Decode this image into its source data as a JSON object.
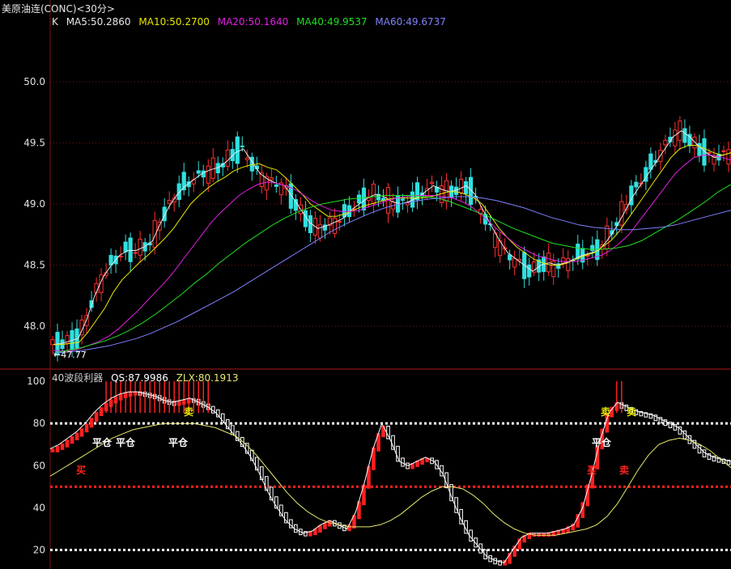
{
  "header": {
    "title": "美原油连(CONC)<30分>"
  },
  "colors": {
    "ma5": "#e8e8e8",
    "ma10": "#e8e800",
    "ma20": "#e020e0",
    "ma40": "#20e020",
    "ma60": "#8080ff",
    "up": "#ff3030",
    "down": "#30e0e0",
    "grid": "#7a1414",
    "qs": "#ffffff",
    "zlx": "#e8e870"
  },
  "ma_legend": {
    "k": "K",
    "ma5": "MA5:50.2860",
    "ma10": "MA10:50.2700",
    "ma20": "MA20:50.1640",
    "ma40": "MA40:49.9537",
    "ma60": "MA60:49.6737"
  },
  "indicator_legend": {
    "name": "40波段利器",
    "qs": "QS:87.9986",
    "zlx": "ZLX:80.1913"
  },
  "chart_data": [
    {
      "type": "candlestick",
      "title": "美原油连(CONC)<30分>",
      "y_ticks": [
        "50.0",
        "49.5",
        "49.0",
        "48.5",
        "48.0"
      ],
      "ylim": [
        47.65,
        50.55
      ],
      "min_label": "47.77",
      "series": [
        {
          "name": "MA5",
          "values": [
            47.85,
            47.86,
            47.88,
            47.9,
            48.05,
            48.25,
            48.4,
            48.5,
            48.58,
            48.62,
            48.62,
            48.65,
            48.7,
            48.85,
            48.98,
            49.08,
            49.15,
            49.2,
            49.25,
            49.28,
            49.3,
            49.35,
            49.42,
            49.45,
            49.35,
            49.25,
            49.2,
            49.17,
            49.15,
            49.05,
            48.95,
            48.85,
            48.8,
            48.82,
            48.85,
            48.88,
            48.95,
            49.0,
            49.05,
            49.08,
            49.06,
            49.02,
            49.0,
            49.02,
            49.05,
            49.1,
            49.15,
            49.12,
            49.1,
            49.12,
            49.15,
            49.08,
            48.95,
            48.82,
            48.7,
            48.6,
            48.55,
            48.5,
            48.45,
            48.5,
            48.52,
            48.5,
            48.52,
            48.55,
            48.58,
            48.6,
            48.62,
            48.7,
            48.8,
            48.92,
            49.05,
            49.15,
            49.25,
            49.35,
            49.45,
            49.55,
            49.6,
            49.55,
            49.48,
            49.42,
            49.38,
            49.4,
            49.42
          ]
        },
        {
          "name": "MA10",
          "values": [
            47.85,
            47.85,
            47.86,
            47.87,
            47.95,
            48.05,
            48.15,
            48.28,
            48.38,
            48.45,
            48.52,
            48.58,
            48.65,
            48.72,
            48.8,
            48.9,
            49.0,
            49.07,
            49.13,
            49.18,
            49.22,
            49.27,
            49.3,
            49.32,
            49.33,
            49.3,
            49.28,
            49.22,
            49.15,
            49.08,
            49.0,
            48.95,
            48.9,
            48.9,
            48.92,
            48.95,
            48.98,
            49.0,
            49.02,
            49.04,
            49.05,
            49.05,
            49.05,
            49.05,
            49.06,
            49.08,
            49.1,
            49.1,
            49.08,
            49.05,
            49.0,
            48.9,
            48.8,
            48.72,
            48.65,
            48.6,
            48.55,
            48.52,
            48.5,
            48.5,
            48.52,
            48.55,
            48.58,
            48.6,
            48.65,
            48.7,
            48.78,
            48.88,
            48.98,
            49.08,
            49.18,
            49.28,
            49.38,
            49.45,
            49.48,
            49.48,
            49.45,
            49.42,
            49.4,
            49.42
          ]
        },
        {
          "name": "MA20",
          "values": [
            47.8,
            47.8,
            47.8,
            47.82,
            47.85,
            47.88,
            47.92,
            47.98,
            48.05,
            48.12,
            48.2,
            48.28,
            48.36,
            48.45,
            48.55,
            48.65,
            48.75,
            48.85,
            48.93,
            49.0,
            49.07,
            49.12,
            49.16,
            49.18,
            49.17,
            49.15,
            49.12,
            49.07,
            49.02,
            48.98,
            48.95,
            48.94,
            48.94,
            48.95,
            48.98,
            49.0,
            49.03,
            49.05,
            49.06,
            49.07,
            49.07,
            49.07,
            49.06,
            49.05,
            49.02,
            48.98,
            48.92,
            48.85,
            48.78,
            48.72,
            48.66,
            48.62,
            48.58,
            48.56,
            48.54,
            48.53,
            48.53,
            48.54,
            48.56,
            48.58,
            48.62,
            48.68,
            48.75,
            48.85,
            48.95,
            49.05,
            49.15,
            49.25,
            49.32,
            49.38,
            49.4,
            49.4,
            49.38,
            49.36
          ]
        },
        {
          "name": "MA40",
          "values": [
            47.78,
            47.8,
            47.82,
            47.85,
            47.88,
            47.92,
            47.97,
            48.03,
            48.1,
            48.18,
            48.26,
            48.35,
            48.43,
            48.52,
            48.6,
            48.68,
            48.75,
            48.82,
            48.88,
            48.93,
            48.97,
            49.0,
            49.02,
            49.04,
            49.05,
            49.06,
            49.07,
            49.07,
            49.07,
            49.06,
            49.05,
            49.02,
            48.98,
            48.94,
            48.9,
            48.85,
            48.8,
            48.76,
            48.72,
            48.68,
            48.66,
            48.64,
            48.63,
            48.63,
            48.64,
            48.66,
            48.7,
            48.76,
            48.82,
            48.88,
            48.95,
            49.02,
            49.1,
            49.16
          ]
        },
        {
          "name": "MA60",
          "values": [
            47.78,
            47.79,
            47.8,
            47.82,
            47.84,
            47.87,
            47.9,
            47.94,
            47.99,
            48.04,
            48.1,
            48.16,
            48.22,
            48.28,
            48.35,
            48.42,
            48.49,
            48.56,
            48.63,
            48.7,
            48.77,
            48.83,
            48.88,
            48.93,
            48.97,
            49.0,
            49.02,
            49.04,
            49.05,
            49.06,
            49.06,
            49.05,
            49.03,
            49.0,
            48.97,
            48.93,
            48.89,
            48.86,
            48.83,
            48.81,
            48.8,
            48.79,
            48.79,
            48.8,
            48.81,
            48.83,
            48.86,
            48.89,
            48.92,
            48.95
          ]
        }
      ]
    },
    {
      "type": "line",
      "title": "40波段利器",
      "y_ticks": [
        "100",
        "80",
        "60",
        "40",
        "20"
      ],
      "ylim": [
        11,
        105
      ],
      "reference_lines": [
        80,
        50,
        20
      ],
      "annotations": [
        "买",
        "平仓",
        "平仓",
        "平仓",
        "卖",
        "平仓",
        "买",
        "卖",
        "卖",
        "卖"
      ],
      "series": [
        {
          "name": "QS",
          "values": [
            68,
            70,
            73,
            76,
            80,
            85,
            89,
            92,
            94,
            95,
            95,
            94,
            93,
            91,
            90,
            91,
            92,
            90,
            88,
            85,
            80,
            75,
            70,
            64,
            56,
            47,
            40,
            34,
            30,
            28,
            29,
            32,
            34,
            32,
            30,
            38,
            52,
            68,
            80,
            72,
            62,
            60,
            62,
            64,
            62,
            56,
            45,
            35,
            27,
            22,
            17,
            15,
            14,
            20,
            26,
            28,
            28,
            28,
            29,
            30,
            32,
            40,
            55,
            72,
            85,
            90,
            88,
            86,
            85,
            84,
            82,
            80,
            78,
            74,
            70,
            66,
            64,
            63,
            62
          ]
        },
        {
          "name": "ZLX",
          "values": [
            55,
            58,
            61,
            64,
            67,
            70,
            73,
            75,
            77,
            78,
            79,
            80,
            80,
            80,
            80,
            79,
            78,
            76,
            74,
            70,
            65,
            59,
            53,
            47,
            42,
            38,
            35,
            33,
            32,
            31,
            31,
            31,
            32,
            34,
            37,
            41,
            45,
            48,
            50,
            50,
            49,
            46,
            42,
            37,
            33,
            30,
            28,
            27,
            27,
            27,
            28,
            29,
            30,
            32,
            36,
            42,
            50,
            58,
            65,
            70,
            72,
            73,
            72,
            70,
            67,
            63,
            59
          ]
        }
      ]
    }
  ]
}
